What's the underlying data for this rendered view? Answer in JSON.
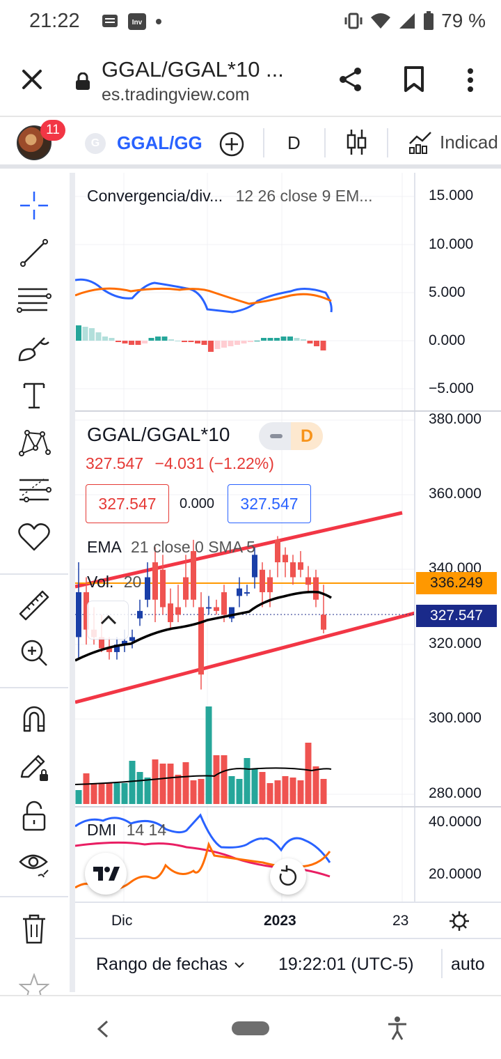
{
  "status_bar": {
    "time": "21:22",
    "battery": "79 %"
  },
  "browser": {
    "title": "GGAL/GGAL*10 ...",
    "url": "es.tradingview.com"
  },
  "toolbar": {
    "notification_count": "11",
    "symbol_initial": "G",
    "symbol": "GGAL/GG",
    "interval": "D",
    "indicators_label": "Indicad"
  },
  "macd_pane": {
    "title": "Convergencia/div...",
    "params": "12 26 close 9 EM...",
    "ticks": [
      "15.000",
      "10.000",
      "5.000",
      "0.000",
      "−5.000"
    ]
  },
  "main_pane": {
    "symbol_title": "GGAL/GGAL*10",
    "pill_interval": "D",
    "last_price": "327.547",
    "change": "−4.031",
    "change_pct": "(−1.22%)",
    "sell_price": "327.547",
    "spread": "0.000",
    "buy_price": "327.547",
    "ema_label": "EMA",
    "ema_params": "21 close 0 SMA 5",
    "vol_label": "Vol.",
    "vol_params": "20",
    "ticks": [
      "380.000",
      "360.000",
      "340.000",
      "320.000",
      "300.000",
      "280.000"
    ],
    "tag_ema": "336.249",
    "tag_last": "327.547"
  },
  "dmi_pane": {
    "label": "DMI",
    "params": "14 14",
    "ticks": [
      "40.0000",
      "20.0000"
    ]
  },
  "time_axis": {
    "labels": [
      "Dic",
      "2023",
      "23"
    ]
  },
  "bottom_bar": {
    "range_label": "Rango de fechas",
    "clock": "19:22:01 (UTC-5)",
    "auto": "auto"
  },
  "colors": {
    "up": "#26a69a",
    "down": "#ef5350",
    "blue_line": "#2962ff",
    "orange_line": "#ff6d00",
    "trend_line": "#f23645",
    "accent": "#2962ff"
  },
  "chart_data": [
    {
      "type": "line",
      "title": "Convergencia/div...",
      "series": [],
      "ylim": [
        -5000,
        15000
      ]
    },
    {
      "type": "candlestick",
      "title": "GGAL/GGAL*10",
      "ylim": [
        276,
        384
      ],
      "candles": [
        {
          "o": 322,
          "h": 342,
          "l": 316,
          "c": 334
        },
        {
          "o": 334,
          "h": 338,
          "l": 320,
          "c": 324
        },
        {
          "o": 324,
          "h": 330,
          "l": 320,
          "c": 322
        },
        {
          "o": 322,
          "h": 328,
          "l": 318,
          "c": 319
        },
        {
          "o": 319,
          "h": 322,
          "l": 316,
          "c": 318
        },
        {
          "o": 318,
          "h": 322,
          "l": 316,
          "c": 320
        },
        {
          "o": 320,
          "h": 324,
          "l": 318,
          "c": 321
        },
        {
          "o": 321,
          "h": 324,
          "l": 319,
          "c": 322
        },
        {
          "o": 327,
          "h": 332,
          "l": 325,
          "c": 329
        },
        {
          "o": 332,
          "h": 342,
          "l": 330,
          "c": 338
        },
        {
          "o": 342,
          "h": 346,
          "l": 326,
          "c": 332
        },
        {
          "o": 340,
          "h": 344,
          "l": 328,
          "c": 330
        },
        {
          "o": 331,
          "h": 335,
          "l": 324,
          "c": 326
        },
        {
          "o": 330,
          "h": 336,
          "l": 326,
          "c": 328
        },
        {
          "o": 338,
          "h": 344,
          "l": 330,
          "c": 332
        },
        {
          "o": 345,
          "h": 348,
          "l": 330,
          "c": 332
        },
        {
          "o": 330,
          "h": 334,
          "l": 308,
          "c": 312
        },
        {
          "o": 330,
          "h": 333,
          "l": 328,
          "c": 330
        },
        {
          "o": 330,
          "h": 332,
          "l": 328,
          "c": 329
        },
        {
          "o": 334,
          "h": 336,
          "l": 326,
          "c": 328
        },
        {
          "o": 327,
          "h": 330,
          "l": 326,
          "c": 330
        },
        {
          "o": 333,
          "h": 338,
          "l": 330,
          "c": 335
        },
        {
          "o": 334,
          "h": 336,
          "l": 333,
          "c": 334
        },
        {
          "o": 338,
          "h": 346,
          "l": 335,
          "c": 344
        },
        {
          "o": 340,
          "h": 342,
          "l": 330,
          "c": 334
        },
        {
          "o": 338,
          "h": 340,
          "l": 330,
          "c": 334
        },
        {
          "o": 348,
          "h": 349,
          "l": 338,
          "c": 342
        },
        {
          "o": 344,
          "h": 346,
          "l": 338,
          "c": 342
        },
        {
          "o": 342,
          "h": 344,
          "l": 336,
          "c": 338
        },
        {
          "o": 342,
          "h": 345,
          "l": 338,
          "c": 340
        },
        {
          "o": 338,
          "h": 341,
          "l": 334,
          "c": 336
        },
        {
          "o": 338,
          "h": 340,
          "l": 330,
          "c": 332
        },
        {
          "o": 328,
          "h": 336,
          "l": 323,
          "c": 324
        }
      ]
    },
    {
      "type": "line",
      "title": "DMI 14 14",
      "series": [],
      "ylim": [
        10,
        42
      ]
    }
  ]
}
